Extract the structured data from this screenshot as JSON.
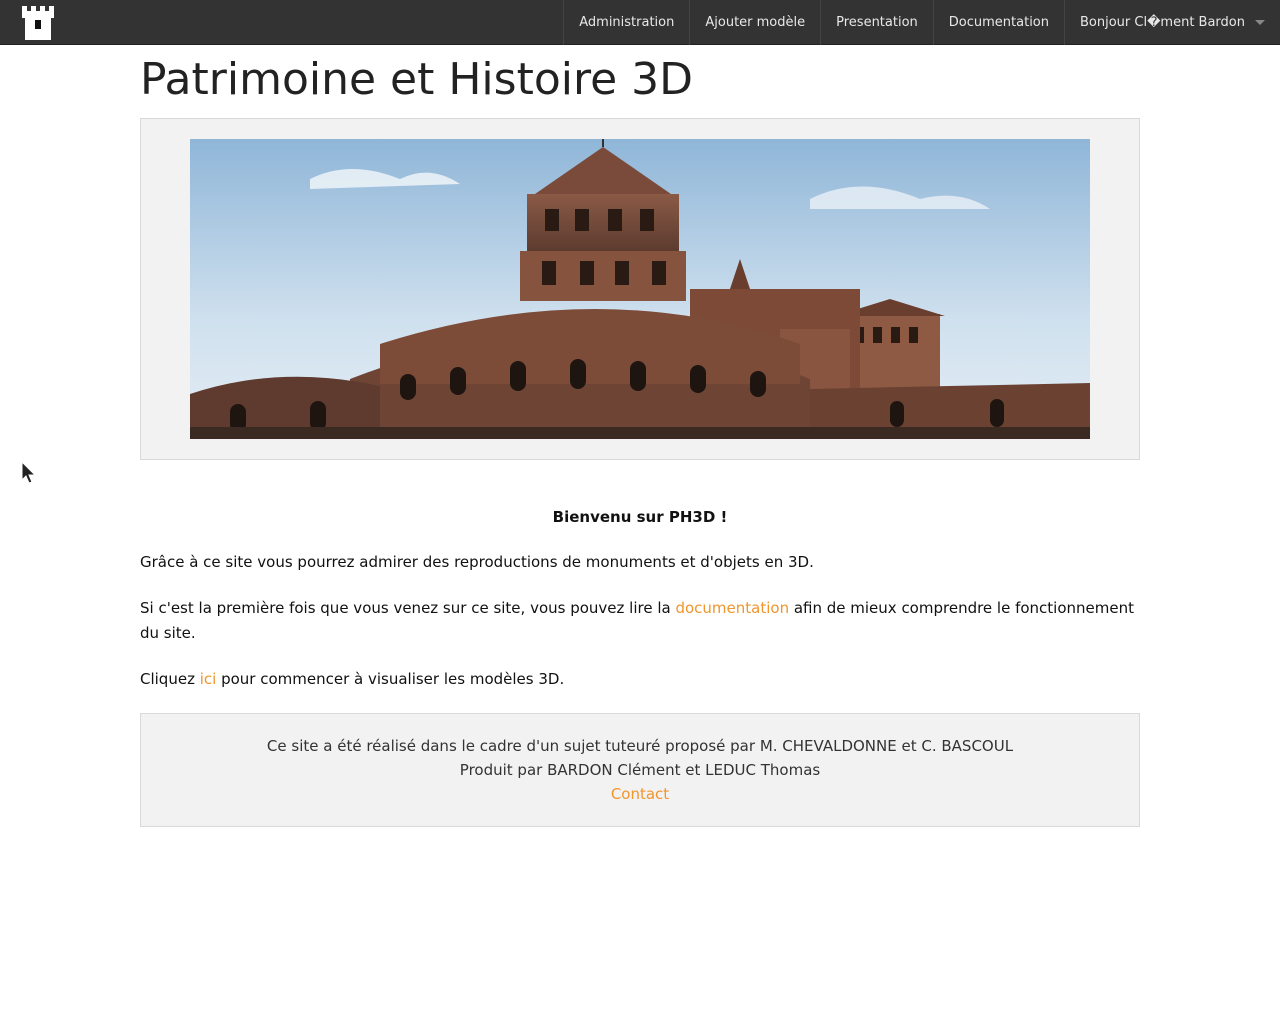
{
  "navbar": {
    "logo_icon": "castle-tower-icon",
    "items": [
      {
        "label": "Administration"
      },
      {
        "label": "Ajouter modèle"
      },
      {
        "label": "Presentation"
      },
      {
        "label": "Documentation"
      }
    ],
    "user_menu": {
      "label": "Bonjour Cl�ment Bardon",
      "icon": "caret-down-icon"
    }
  },
  "page": {
    "title": "Patrimoine et Histoire 3D",
    "hero_image": "romanesque-basilica-photo"
  },
  "content": {
    "welcome": "Bienvenu sur PH3D !",
    "para1": "Grâce à ce site vous pourrez admirer des reproductions de monuments et d'objets en 3D.",
    "para2_before": "Si c'est la première fois que vous venez sur ce site, vous pouvez lire la ",
    "para2_link": "documentation",
    "para2_after": " afin de mieux comprendre le fonctionnement du site.",
    "para3_before": "Cliquez ",
    "para3_link": "ici",
    "para3_after": " pour commencer à visualiser les modèles 3D."
  },
  "footer": {
    "line1": "Ce site a été réalisé dans le cadre d'un sujet tuteuré proposé par M. CHEVALDONNE et C. BASCOUL",
    "line2": "Produit par BARDON Clément et LEDUC Thomas",
    "contact": "Contact"
  },
  "colors": {
    "navbar_bg": "#333333",
    "link": "#f0962c",
    "well_bg": "#f2f2f2"
  }
}
